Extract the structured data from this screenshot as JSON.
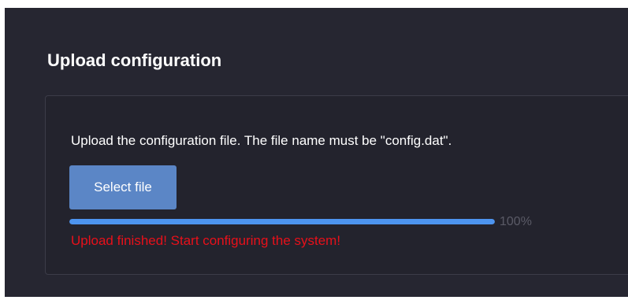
{
  "page": {
    "title": "Upload configuration"
  },
  "upload": {
    "description": "Upload the configuration file. The file name must be \"config.dat\".",
    "select_label": "Select file",
    "progress_value": 100,
    "progress_text": "100%",
    "status_message": "Upload finished! Start configuring the system!"
  },
  "colors": {
    "panel_background": "#262631",
    "button": "#5b86c6",
    "progress_fill": "#4d94ef",
    "status_error": "#e8101a"
  }
}
